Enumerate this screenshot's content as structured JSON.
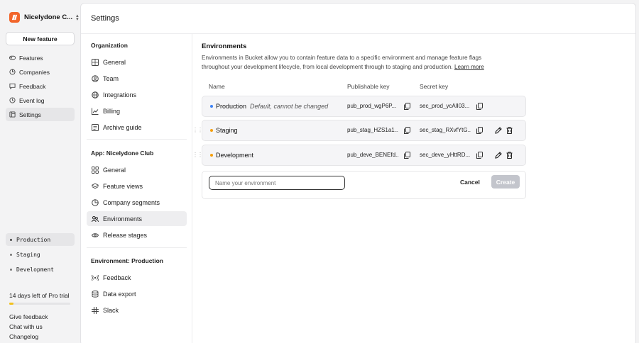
{
  "org": {
    "name": "Nicelydone C..."
  },
  "left_nav": {
    "new_feature": "New feature",
    "items": [
      {
        "label": "Features",
        "icon": "toggle-icon"
      },
      {
        "label": "Companies",
        "icon": "companies-icon"
      },
      {
        "label": "Feedback",
        "icon": "feedback-icon"
      },
      {
        "label": "Event log",
        "icon": "event-log-icon"
      },
      {
        "label": "Settings",
        "icon": "settings-icon",
        "active": true
      }
    ],
    "environments": [
      {
        "label": "Production",
        "active": true
      },
      {
        "label": "Staging"
      },
      {
        "label": "Development"
      }
    ],
    "trial_text": "14 days left of Pro trial",
    "trial_progress": 0.07,
    "footer_links": [
      "Give feedback",
      "Chat with us",
      "Changelog"
    ]
  },
  "settings": {
    "title": "Settings",
    "organization": {
      "heading": "Organization",
      "items": [
        "General",
        "Team",
        "Integrations",
        "Billing",
        "Archive guide"
      ]
    },
    "app": {
      "heading": "App: Nicelydone Club",
      "items": [
        "General",
        "Feature views",
        "Company segments",
        "Environments",
        "Release stages"
      ],
      "active": "Environments"
    },
    "environment": {
      "heading": "Environment: Production",
      "items": [
        "Feedback",
        "Data export",
        "Slack"
      ]
    }
  },
  "environments_page": {
    "title": "Environments",
    "description": "Environments in Bucket allow you to contain feature data to a specific environment and manage feature flags throughout your development lifecycle, from local development through to staging and production.",
    "learn_more": "Learn more",
    "columns": {
      "name": "Name",
      "publishable": "Publishable key",
      "secret": "Secret key"
    },
    "rows": [
      {
        "name": "Production",
        "note": "Default, cannot be changed",
        "publishable": "pub_prod_wgP6P...",
        "secret": "sec_prod_ycAlI03...",
        "color": "#3b82f6",
        "editable": false
      },
      {
        "name": "Staging",
        "note": "",
        "publishable": "pub_stag_HZS1a1...",
        "secret": "sec_stag_RXvfYtG...",
        "color": "#f59e0b",
        "editable": true
      },
      {
        "name": "Development",
        "note": "",
        "publishable": "pub_deve_BENEfd...",
        "secret": "sec_deve_yHttRD...",
        "color": "#f59e0b",
        "editable": true
      }
    ],
    "new_env_placeholder": "Name your environment",
    "cancel": "Cancel",
    "create": "Create"
  },
  "colors": {
    "brand": "#f2652a",
    "trial": "#f2c11d",
    "create_disabled": "#c3c5cc"
  }
}
